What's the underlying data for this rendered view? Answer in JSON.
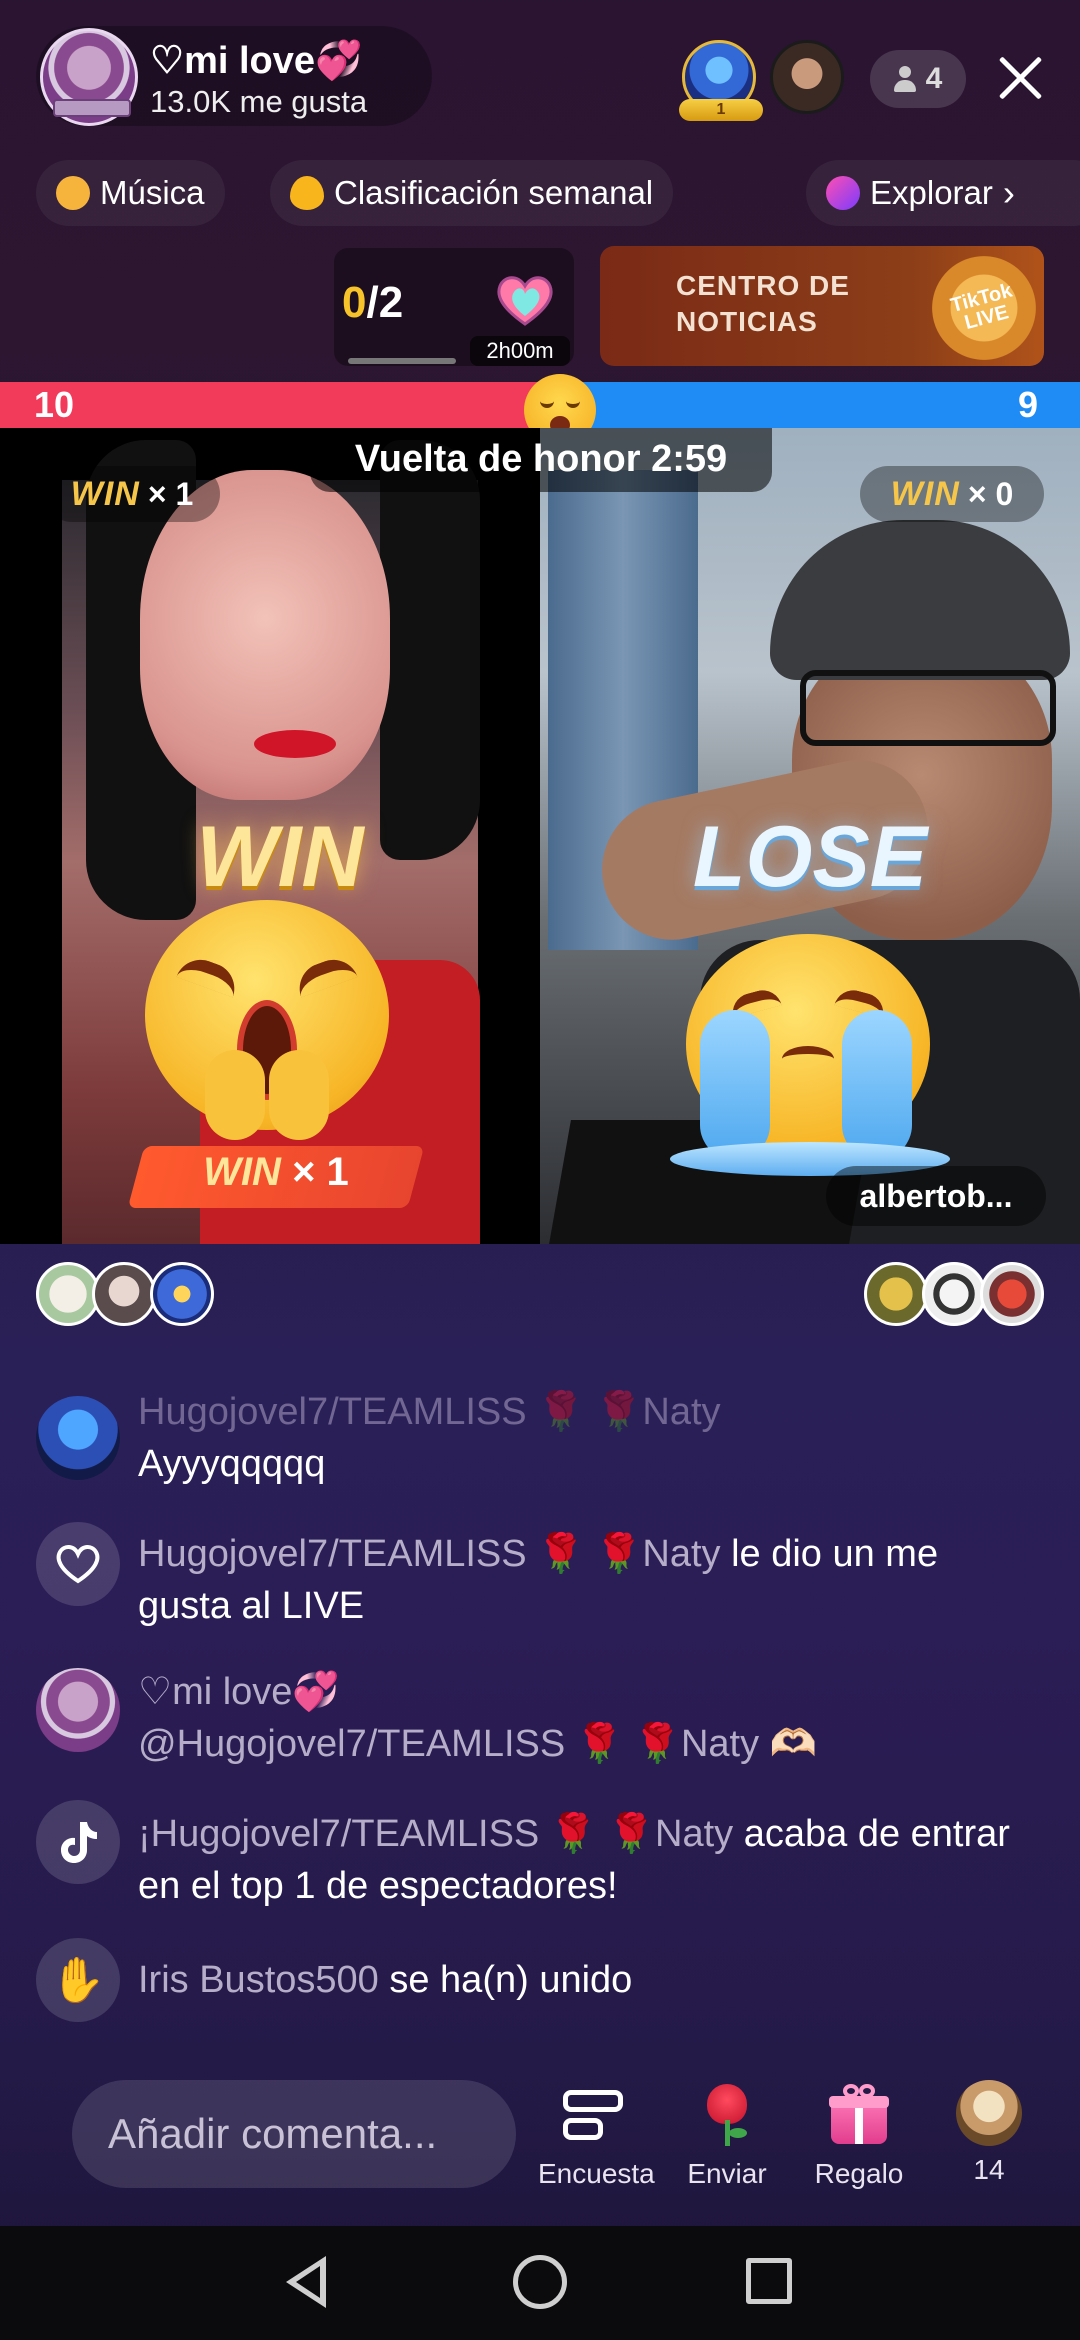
{
  "header": {
    "host_name": "♡mi love💞",
    "host_likes": "13.0K me gusta",
    "top_viewer_badge": "1",
    "viewer_count": "4"
  },
  "chips": [
    {
      "label": "Música",
      "icon": "music-icon"
    },
    {
      "label": "Clasificación semanal",
      "icon": "flame-icon"
    },
    {
      "label": "Explorar",
      "icon": "planet-icon"
    }
  ],
  "goal": {
    "current": "0",
    "total": "/2",
    "time": "2h00m"
  },
  "news": {
    "label": "CENTRO DE NOTICIAS",
    "logo": "TikTok LIVE"
  },
  "battle": {
    "score_left": "10",
    "score_right": "9",
    "timer": "Vuelta de honor 2:59",
    "left_win_word": "WIN",
    "left_win_count": "× 1",
    "right_win_word": "WIN",
    "right_win_count": "× 0",
    "left_result": "WIN",
    "right_result": "LOSE",
    "left_banner_word": "WIN",
    "left_banner_count": "× 1",
    "opponent_name": "albertob..."
  },
  "chat": [
    {
      "user": "Hugojovel7/TEAMLISS 🌹 🌹Naty",
      "text": "Ayyyqqqqq",
      "avatar": "user-avatar"
    },
    {
      "user": "Hugojovel7/TEAMLISS 🌹 🌹Naty",
      "text": " le dio un me gusta al LIVE",
      "avatar": "heart-icon"
    },
    {
      "user": "♡mi love💞",
      "text": "@Hugojovel7/TEAMLISS 🌹 🌹Naty 🫶🏻",
      "avatar": "host-avatar"
    },
    {
      "user": "¡Hugojovel7/TEAMLISS 🌹 🌹Naty",
      "text": " acaba de entrar en el top 1 de espectadores!",
      "avatar": "tiktok-icon"
    },
    {
      "user": "Iris Bustos500",
      "text": " se ha(n) unido",
      "avatar": "wave-icon"
    }
  ],
  "bottom": {
    "comment_placeholder": "Añadir comenta...",
    "poll_label": "Encuesta",
    "send_label": "Enviar",
    "gift_label": "Regalo",
    "count_label": "14"
  },
  "colors": {
    "red_team": "#f23a5a",
    "blue_team": "#1f8cf5",
    "win_gold": "#f6c64a"
  }
}
